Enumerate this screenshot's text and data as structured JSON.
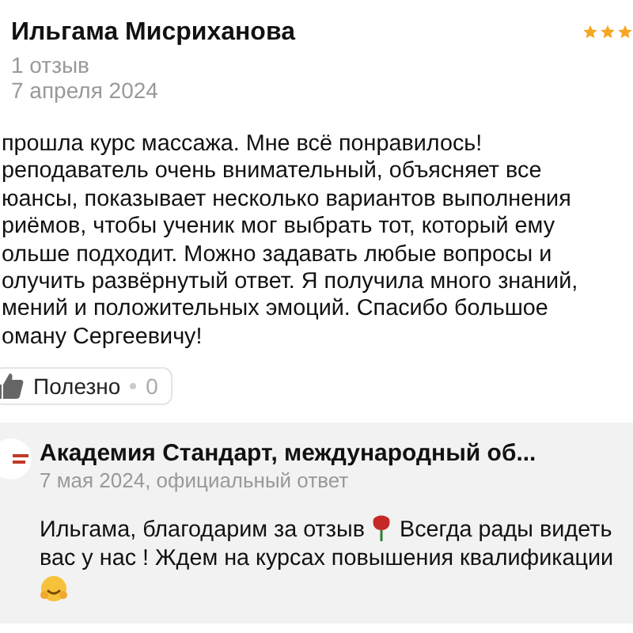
{
  "review": {
    "author": "Ильгама Мисриханова",
    "stars": 3,
    "reviews_count": "1 отзыв",
    "date": "7 апреля 2024",
    "text": "прошла курс массажа. Мне всё понравилось!\nреподаватель очень внимательный, объясняет все\nюансы, показывает несколько вариантов выполнения\nриёмов, чтобы ученик мог выбрать тот, который ему\nольше подходит. Можно задавать любые вопросы и\nолучить развёрнутый ответ. Я получила много знаний,\nмений и положительных эмоций. Спасибо большое\nоману Сергеевичу!",
    "helpful": {
      "label": "Полезно",
      "count": "0"
    }
  },
  "reply": {
    "author": "Академия Стандарт, международный об...",
    "meta": "7 мая 2024, официальный ответ",
    "segments": [
      {
        "kind": "text",
        "text": "Ильгама, благодарим за отзыв "
      },
      {
        "kind": "rose"
      },
      {
        "kind": "text",
        "text": " Всегда рады видеть\nвас у нас ! Ждем на курсах повышения квалификации"
      },
      {
        "kind": "smile"
      }
    ]
  }
}
